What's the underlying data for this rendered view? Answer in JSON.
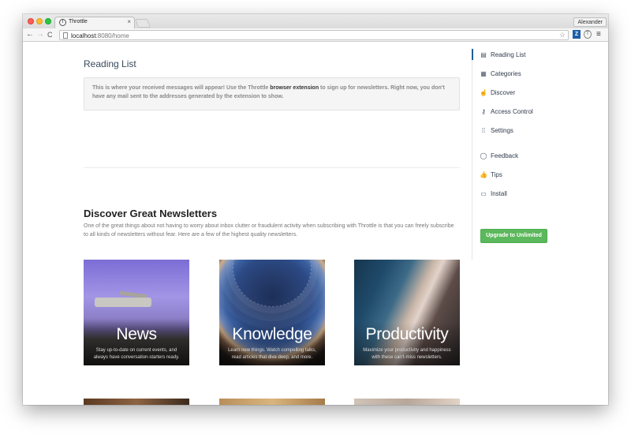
{
  "browser": {
    "tab_title": "Throttle",
    "tab_close": "×",
    "profile_name": "Alexander",
    "url_host": "localhost",
    "url_rest": ":8080/home",
    "back_icon": "←",
    "forward_icon": "→",
    "reload_icon": "C",
    "star_icon": "☆",
    "ext_z_label": "Z",
    "menu_icon": "≡"
  },
  "main": {
    "reading_list_heading": "Reading List",
    "alert_part1": "This is where your received messages will appear! Use the Throttle ",
    "alert_link": "browser extension",
    "alert_part2": " to sign up for newsletters. Right now, you don't have any mail sent to the addresses generated by the extension to show.",
    "discover_title": "Discover Great Newsletters",
    "discover_desc": "One of the great things about not having to worry about inbox clutter or fraudulent activity when subscribing with Throttle is that you can freely subscribe to all kinds of newsletters without fear. Here are a few of the highest quality newsletters.",
    "cards": [
      {
        "title": "News",
        "subtitle": "Stay up-to-date on current events, and always have conversation-starters ready."
      },
      {
        "title": "Knowledge",
        "subtitle": "Learn new things. Watch compelling talks, read articles that dive deep, and more."
      },
      {
        "title": "Productivity",
        "subtitle": "Maximize your productivity and happiness with these can't-miss newsletters."
      }
    ]
  },
  "sidebar": {
    "items": [
      {
        "label": "Reading List",
        "icon": "reading-list-icon",
        "glyph": "▤"
      },
      {
        "label": "Categories",
        "icon": "categories-icon",
        "glyph": "▦"
      },
      {
        "label": "Discover",
        "icon": "discover-icon",
        "glyph": "☝"
      },
      {
        "label": "Access Control",
        "icon": "key-icon",
        "glyph": "⚷"
      },
      {
        "label": "Settings",
        "icon": "settings-icon",
        "glyph": "⁞⁞"
      },
      {
        "label": "Feedback",
        "icon": "feedback-icon",
        "glyph": "◯"
      },
      {
        "label": "Tips",
        "icon": "thumbs-up-icon",
        "glyph": "👍"
      },
      {
        "label": "Install",
        "icon": "monitor-icon",
        "glyph": "▭"
      }
    ],
    "upgrade_label": "Upgrade to Unlimited"
  },
  "colors": {
    "accent": "#1f5e96",
    "upgrade_green": "#5cb85c"
  }
}
